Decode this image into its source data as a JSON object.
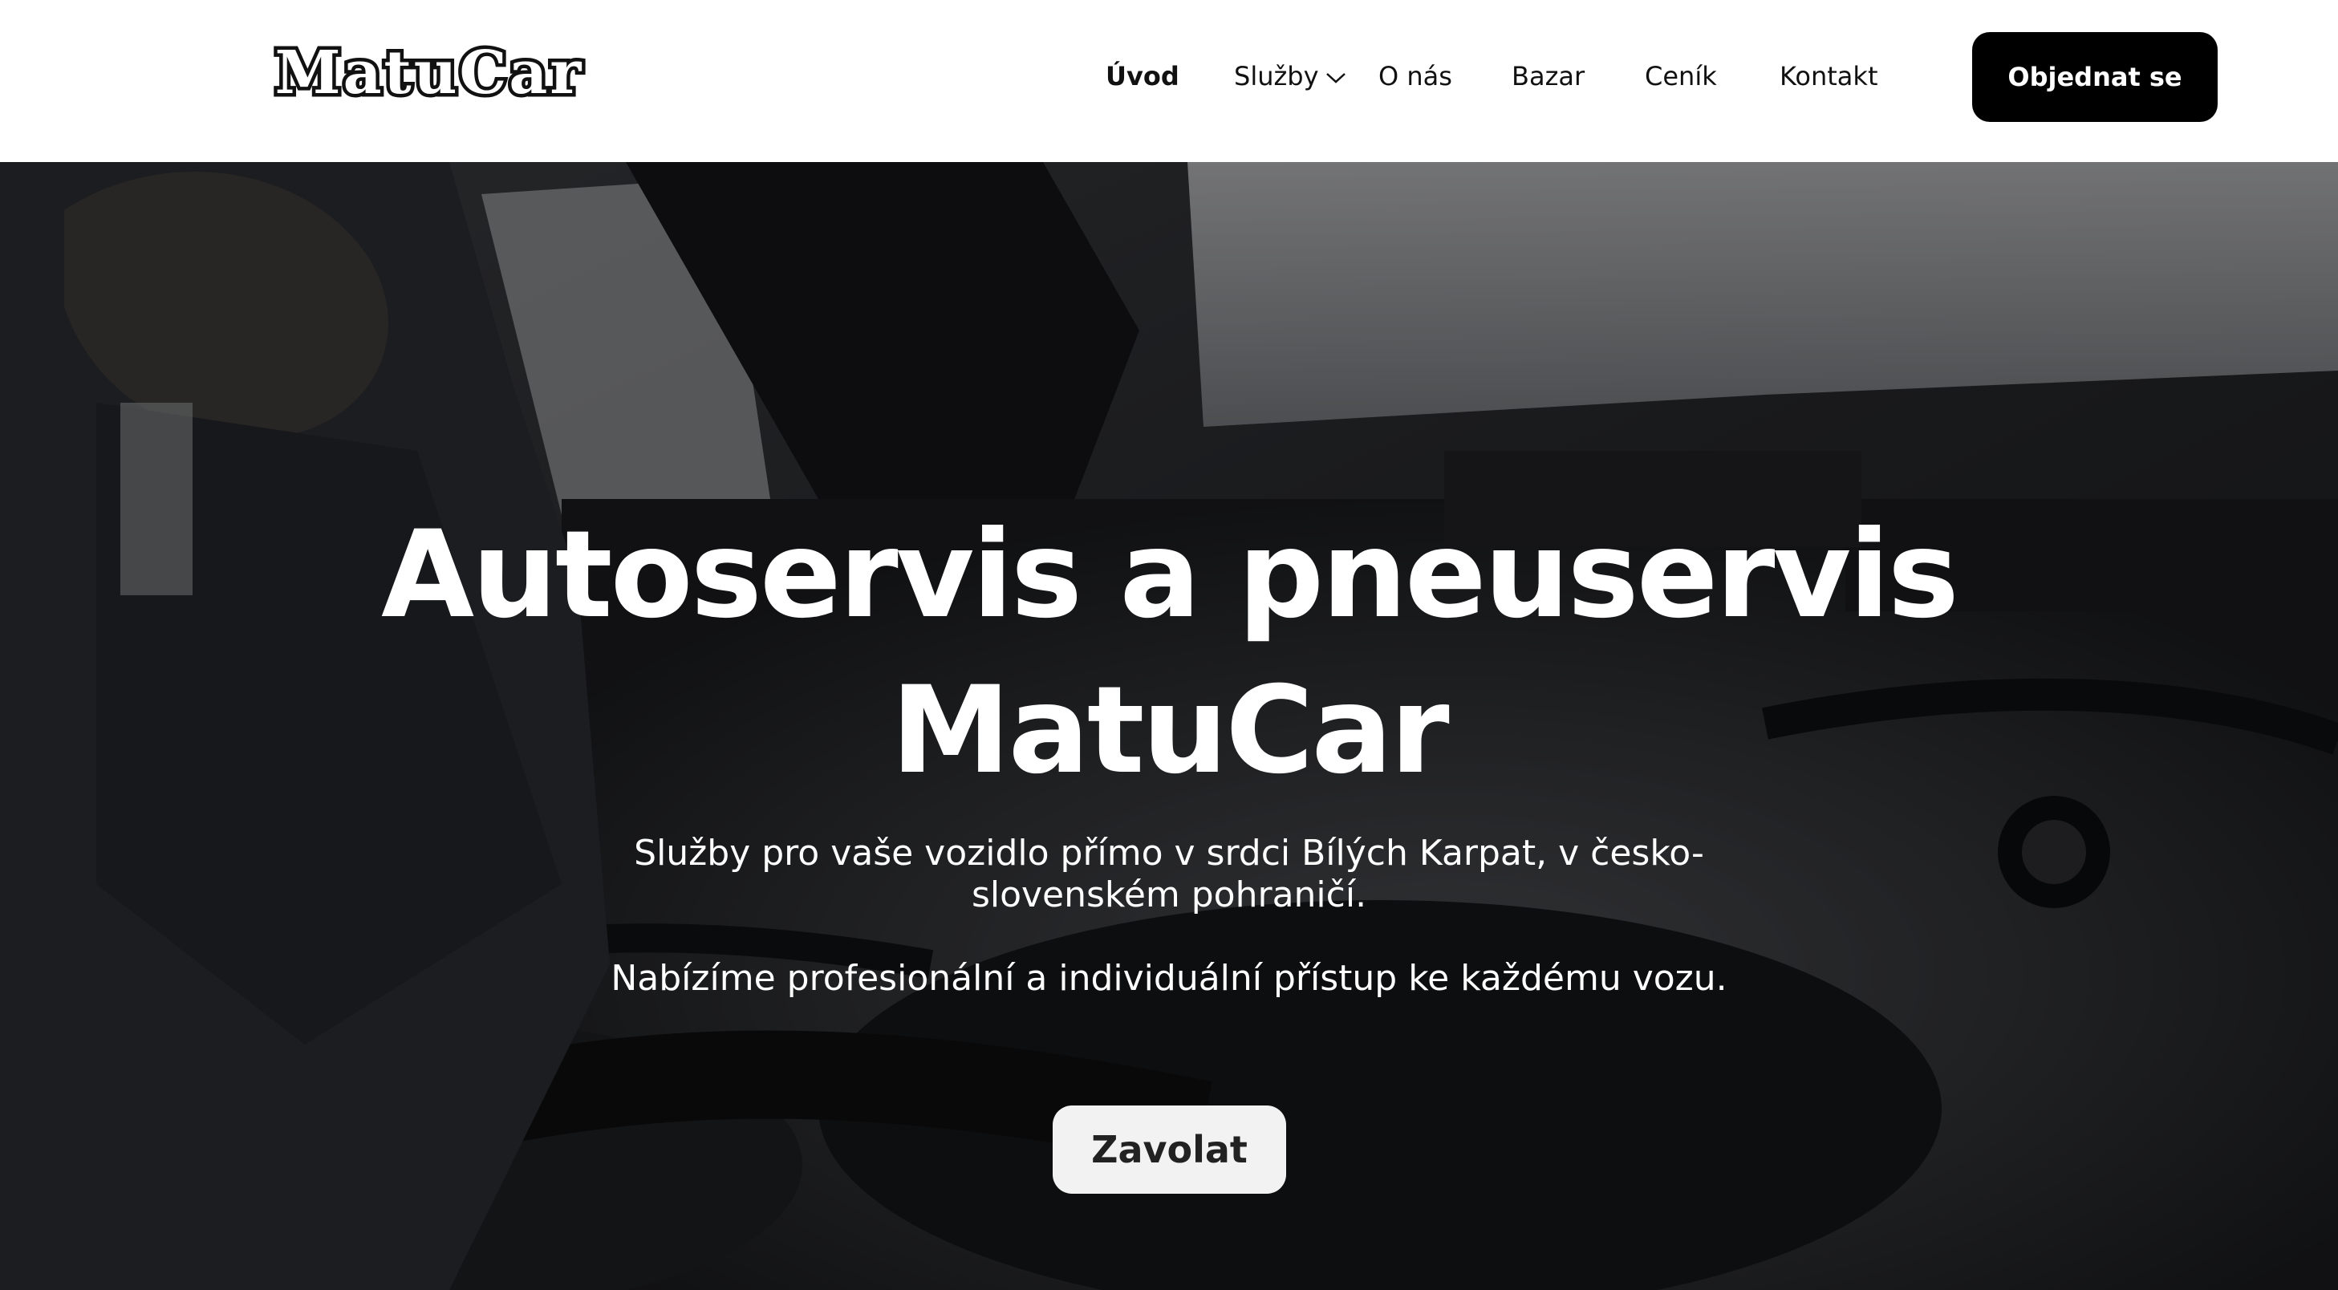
{
  "brand": {
    "logo_text": "MatuCar"
  },
  "nav": {
    "items": [
      {
        "label": "Úvod",
        "active": true
      },
      {
        "label": "Služby",
        "has_dropdown": true,
        "dropdown_icon": "chevron-down-icon"
      },
      {
        "label": "O nás"
      },
      {
        "label": "Bazar"
      },
      {
        "label": "Ceník"
      },
      {
        "label": "Kontakt"
      }
    ],
    "cta_label": "Objednat se"
  },
  "hero": {
    "title_line1": "Autoservis a pneuservis",
    "title_line2": "MatuCar",
    "subtitle_1": "Služby pro vaše vozidlo přímo v srdci Bílých Karpat, v česko-slovenském pohraničí.",
    "subtitle_2": "Nabízíme profesionální a individuální přístup ke každému vozu.",
    "call_button_label": "Zavolat"
  },
  "colors": {
    "header_bg": "#ffffff",
    "cta_bg": "#000000",
    "cta_text": "#ffffff",
    "hero_text": "#ffffff",
    "call_button_bg": "#f2f2f2"
  }
}
